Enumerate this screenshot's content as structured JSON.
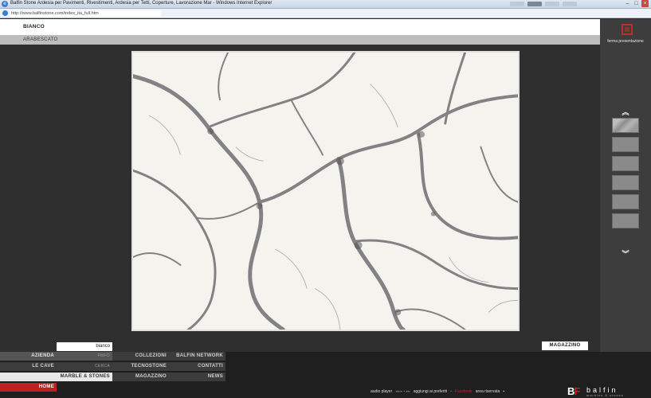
{
  "browser": {
    "title": "Balfin Stone Ardesia per Pavimenti, Rivestimenti, Ardesia per Tetti, Coperture, Lavorazione Mar - Windows Internet Explorer",
    "url": "http://www.balfinstone.com/index_ita_full.htm",
    "icon": "ie-icon"
  },
  "header": {
    "material": "BIANCO",
    "variant": "ARABESCATO"
  },
  "right_panel": {
    "stop_label": "ferma presentazione",
    "up_icon": "double-chevron-up-icon",
    "down_icon": "double-chevron-down-icon",
    "up_glyph": "︽",
    "down_glyph": "︾"
  },
  "search": {
    "value": "bianco"
  },
  "magazzino_button": "MAGAZZINO",
  "menu": {
    "col1": [
      "AZIENDA",
      "LE CAVE",
      "MARBLE & STONES",
      "HOME"
    ],
    "col1_sub": [
      "FMFO",
      "CERCA"
    ],
    "col2": [
      "COLLEZIONI",
      "TECNOSTONE",
      "MAGAZZINO"
    ],
    "col3": [
      "BALFIN NETWORK",
      "CONTATTI",
      "NEWS"
    ]
  },
  "footer": {
    "audio_player": "audio player",
    "controls": "◂◂ ▸ ▪ ▸▸",
    "favorites": "aggiungi ai preferiti",
    "facebook": "Facebook",
    "reserved": "area riservata",
    "logo_mark": "B",
    "logo_mark_accent": "F",
    "logo_name": "balfin",
    "logo_tag": "marbles & stones"
  },
  "colors": {
    "accent": "#c0201e",
    "background": "#2f2f2f"
  }
}
